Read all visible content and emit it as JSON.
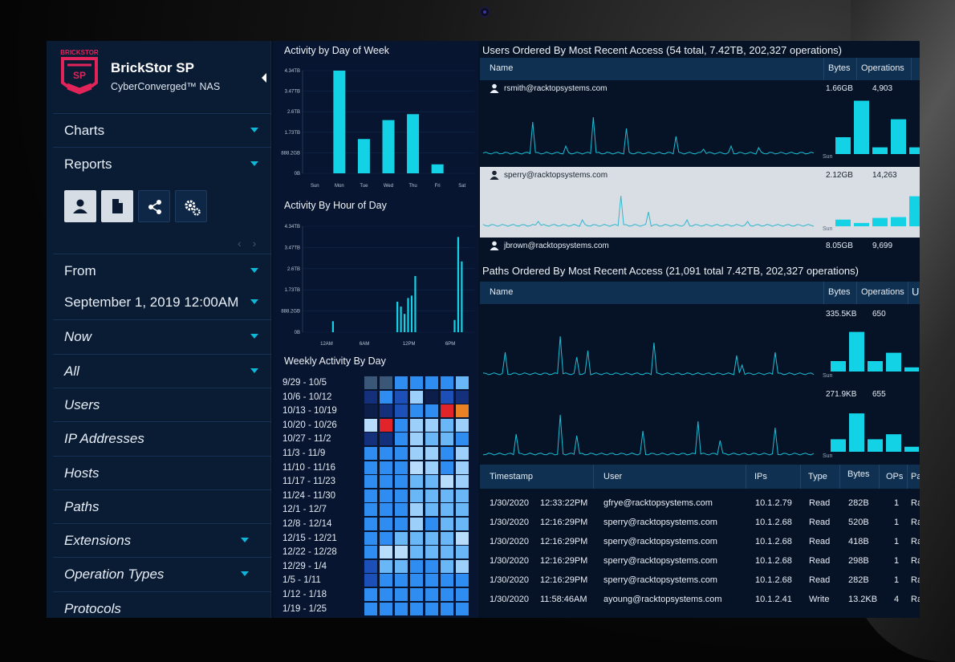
{
  "brand": {
    "title": "BrickStor SP",
    "subtitle": "CyberConverged™ NAS",
    "logo_text": "BRICKSTOR",
    "logo_badge": "SP",
    "accent": "#e2245a"
  },
  "sidebar": {
    "menu": [
      {
        "label": "Charts",
        "dropdown": true
      },
      {
        "label": "Reports",
        "dropdown": true
      }
    ],
    "icons": [
      "user-icon",
      "document-icon",
      "share-icon",
      "settings-icon"
    ],
    "filters": [
      {
        "label": "From",
        "dropdown": true
      },
      {
        "label": "September 1, 2019 12:00AM",
        "dropdown": true
      },
      {
        "label": "Now",
        "dropdown": true
      },
      {
        "label": "All",
        "dropdown": true
      },
      {
        "label": "Users",
        "dropdown": false
      },
      {
        "label": "IP Addresses",
        "dropdown": false
      },
      {
        "label": "Hosts",
        "dropdown": false
      },
      {
        "label": "Paths",
        "dropdown": false
      },
      {
        "label": "Extensions",
        "dropdown": true
      },
      {
        "label": "Operation Types",
        "dropdown": true
      },
      {
        "label": "Protocols",
        "dropdown": false
      }
    ]
  },
  "charts": {
    "day_of_week": {
      "title": "Activity by Day of Week",
      "y_ticks": [
        "4.34TB",
        "3.47TB",
        "2.6TB",
        "1.73TB",
        "888.2GB",
        "0B"
      ],
      "categories": [
        "Sun",
        "Mon",
        "Tue",
        "Wed",
        "Thu",
        "Fri",
        "Sat"
      ],
      "values_tb": [
        0,
        4.34,
        1.45,
        2.25,
        2.5,
        0.38,
        0
      ]
    },
    "hour_of_day": {
      "title": "Activity By Hour of Day",
      "y_ticks": [
        "4.34TB",
        "3.47TB",
        "2.6TB",
        "1.73TB",
        "888.2GB",
        "0B"
      ],
      "x_ticks": [
        "12AM",
        "6AM",
        "12PM",
        "6PM"
      ],
      "values_tb": [
        0,
        0,
        0,
        0,
        0,
        0,
        0,
        0,
        0.45,
        0,
        0,
        0,
        0,
        0,
        0,
        0,
        0,
        0,
        0,
        0,
        0,
        0,
        0,
        0,
        0,
        0,
        1.25,
        1.05,
        0.75,
        1.4,
        1.5,
        2.3,
        0,
        0,
        0,
        0,
        0,
        0,
        0,
        0,
        0,
        0,
        0.5,
        3.9,
        2.9,
        0,
        0,
        0
      ]
    },
    "weekly": {
      "title": "Weekly Activity By Day",
      "weeks": [
        "9/29 - 10/5",
        "10/6 - 10/12",
        "10/13 - 10/19",
        "10/20 - 10/26",
        "10/27 - 11/2",
        "11/3 - 11/9",
        "11/10 - 11/16",
        "11/17 - 11/23",
        "11/24 - 11/30",
        "12/1 - 12/7",
        "12/8 - 12/14",
        "12/15 - 12/21",
        "12/22 - 12/28",
        "12/29 - 1/4",
        "1/5 - 1/11",
        "1/12 - 1/18",
        "1/19 - 1/25"
      ],
      "colors": {
        "a": "#3a5777",
        "b": "#2f6db5",
        "c": "#1c4fb7",
        "d": "#2f8cf0",
        "e": "#69b7f7",
        "f": "#9ccff9",
        "g": "#b8ddfc",
        "h": "#15307a",
        "r": "#e0242a",
        "o": "#e98224",
        "k": "#0e1e4a"
      },
      "grid": [
        "aadddde",
        "hdcfkch",
        "khcddro",
        "grdffef",
        "hhdfeed",
        "dddffdf",
        "dddgfdf",
        "dddeegf",
        "dddeeee",
        "dddfeee",
        "dddfdee",
        "ddeeeeg",
        "dggeeee",
        "ceeddef",
        "cdddddd",
        "ddddddd",
        "ddddddd"
      ]
    }
  },
  "users": {
    "title": "Users Ordered By Most Recent Access (54 total, 7.42TB, 202,327 operations)",
    "columns": [
      "Name",
      "Bytes",
      "Operations"
    ],
    "rows": [
      {
        "name": "rsmith@racktopsystems.com",
        "bytes": "1.66GB",
        "ops": "4,903",
        "sun": "Sun",
        "selected": false
      },
      {
        "name": "sperry@racktopsystems.com",
        "bytes": "2.12GB",
        "ops": "14,263",
        "sun": "Sun",
        "selected": true
      },
      {
        "name": "jbrown@racktopsystems.com",
        "bytes": "8.05GB",
        "ops": "9,699",
        "sun": "",
        "selected": false
      }
    ]
  },
  "paths": {
    "title": "Paths Ordered By Most Recent Access (21,091 total 7.42TB, 202,327 operations)",
    "columns": [
      "Name",
      "Bytes",
      "Operations",
      "U"
    ],
    "rows": [
      {
        "bytes": "335.5KB",
        "ops": "650",
        "sun": "Sun"
      },
      {
        "bytes": "271.9KB",
        "ops": "655",
        "sun": "Sun"
      }
    ]
  },
  "log": {
    "columns": [
      "Timestamp",
      "User",
      "IPs",
      "Type",
      "Bytes",
      "OPs",
      "Pa"
    ],
    "rows": [
      {
        "date": "1/30/2020",
        "time": "12:33:22PM",
        "user": "gfrye@racktopsystems.com",
        "ip": "10.1.2.79",
        "type": "Read",
        "bytes": "282B",
        "ops": "1",
        "path": "Ra"
      },
      {
        "date": "1/30/2020",
        "time": "12:16:29PM",
        "user": "sperry@racktopsystems.com",
        "ip": "10.1.2.68",
        "type": "Read",
        "bytes": "520B",
        "ops": "1",
        "path": "Ra"
      },
      {
        "date": "1/30/2020",
        "time": "12:16:29PM",
        "user": "sperry@racktopsystems.com",
        "ip": "10.1.2.68",
        "type": "Read",
        "bytes": "418B",
        "ops": "1",
        "path": "Ra"
      },
      {
        "date": "1/30/2020",
        "time": "12:16:29PM",
        "user": "sperry@racktopsystems.com",
        "ip": "10.1.2.68",
        "type": "Read",
        "bytes": "298B",
        "ops": "1",
        "path": "Ra"
      },
      {
        "date": "1/30/2020",
        "time": "12:16:29PM",
        "user": "sperry@racktopsystems.com",
        "ip": "10.1.2.68",
        "type": "Read",
        "bytes": "282B",
        "ops": "1",
        "path": "Ra"
      },
      {
        "date": "1/30/2020",
        "time": "11:58:46AM",
        "user": "ayoung@racktopsystems.com",
        "ip": "10.1.2.41",
        "type": "Write",
        "bytes": "13.2KB",
        "ops": "4",
        "path": "Ra"
      }
    ]
  },
  "theme": {
    "accent_cyan": "#14d2e6",
    "caret": "#10b6d8",
    "panel": "#0a1b34",
    "header": "#0f3050"
  }
}
